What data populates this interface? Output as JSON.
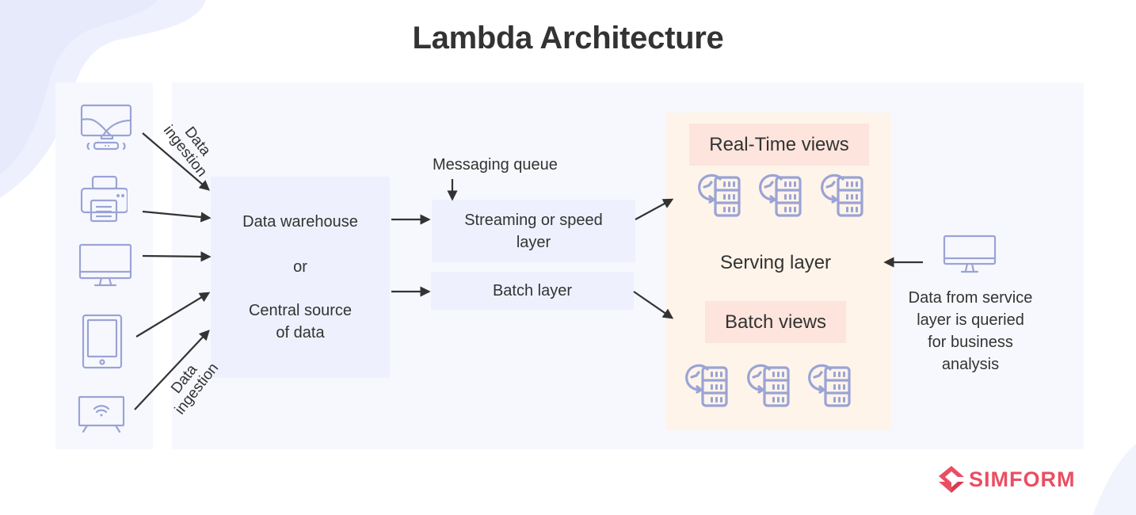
{
  "title": "Lambda Architecture",
  "colors": {
    "icon_stroke": "#9aa3d4",
    "panel_bg": "#f7f8fe",
    "box_bg": "#eef1fd",
    "serving_bg": "#fef4ea",
    "view_label_bg": "#fde4dc",
    "arrow": "#333333",
    "brand": "#ea4e62"
  },
  "sources": [
    {
      "name": "smart-tv-device",
      "icon": "tv-with-streaming-stick-icon"
    },
    {
      "name": "printer",
      "icon": "printer-icon"
    },
    {
      "name": "desktop-monitor",
      "icon": "monitor-icon"
    },
    {
      "name": "tablet",
      "icon": "tablet-icon"
    },
    {
      "name": "wifi-tv",
      "icon": "wifi-tv-icon"
    }
  ],
  "ingestion_labels": {
    "top": [
      "Data",
      "ingestion"
    ],
    "bottom": [
      "Data",
      "ingestion"
    ]
  },
  "warehouse": {
    "line1": "Data warehouse",
    "line2": "or",
    "line3": "Central source",
    "line4": "of data"
  },
  "messaging_queue": "Messaging queue",
  "streaming_layer": {
    "line1": "Streaming or speed",
    "line2": "layer"
  },
  "batch_layer": "Batch layer",
  "serving": {
    "title": "Serving layer",
    "realtime_views": "Real-Time views",
    "batch_views": "Batch views",
    "realtime_icon_count": 3,
    "batch_icon_count": 3
  },
  "client": {
    "icon": "monitor-icon",
    "text_lines": [
      "Data from service",
      "layer is queried",
      "for business",
      "analysis"
    ]
  },
  "brand": {
    "name": "SIMFORM"
  }
}
